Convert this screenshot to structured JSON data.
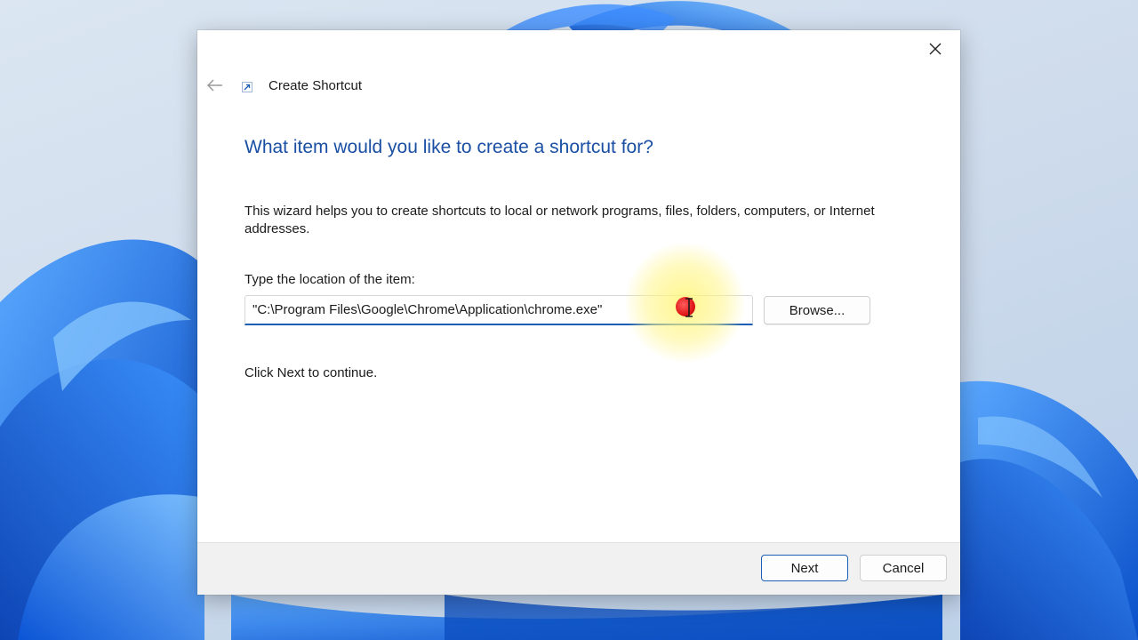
{
  "window": {
    "title": "Create Shortcut",
    "title_icon": "shortcut-arrow-icon",
    "back_icon": "back-arrow-icon",
    "close_icon": "close-icon"
  },
  "wizard": {
    "heading": "What item would you like to create a shortcut for?",
    "description": "This wizard helps you to create shortcuts to local or network programs, files, folders, computers, or Internet addresses.",
    "location_label": "Type the location of the item:",
    "location_value": "\"C:\\Program Files\\Google\\Chrome\\Application\\chrome.exe\"",
    "browse_label": "Browse...",
    "continue_text": "Click Next to continue."
  },
  "footer": {
    "next_label": "Next",
    "cancel_label": "Cancel"
  },
  "colors": {
    "heading": "#1a4fa3",
    "input_focus_border": "#1a5fb4",
    "footer_bg": "#f1f1f1",
    "wallpaper_accent": "#1e6fe0"
  }
}
